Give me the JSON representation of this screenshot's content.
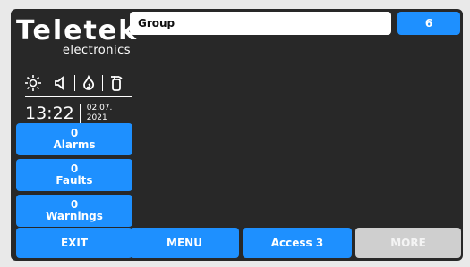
{
  "brand": {
    "name": "Teletek",
    "subtitle": "electronics"
  },
  "status_icons": [
    {
      "icon": "sun-icon"
    },
    {
      "icon": "speaker-icon"
    },
    {
      "icon": "fire-icon"
    },
    {
      "icon": "extinguisher-icon"
    }
  ],
  "clock": {
    "time": "13:22",
    "date_line1": "02.07.",
    "date_line2": "2021"
  },
  "counters": [
    {
      "count": "0",
      "label": "Alarms"
    },
    {
      "count": "0",
      "label": "Faults"
    },
    {
      "count": "0",
      "label": "Warnings"
    }
  ],
  "group": {
    "label": "Group",
    "count": "6"
  },
  "bottom_bar": {
    "exit": "EXIT",
    "menu": "MENU",
    "access": "Access 3",
    "more": "MORE"
  },
  "colors": {
    "accent": "#1e90ff",
    "background": "#282828",
    "disabled": "#cfcfcf"
  }
}
